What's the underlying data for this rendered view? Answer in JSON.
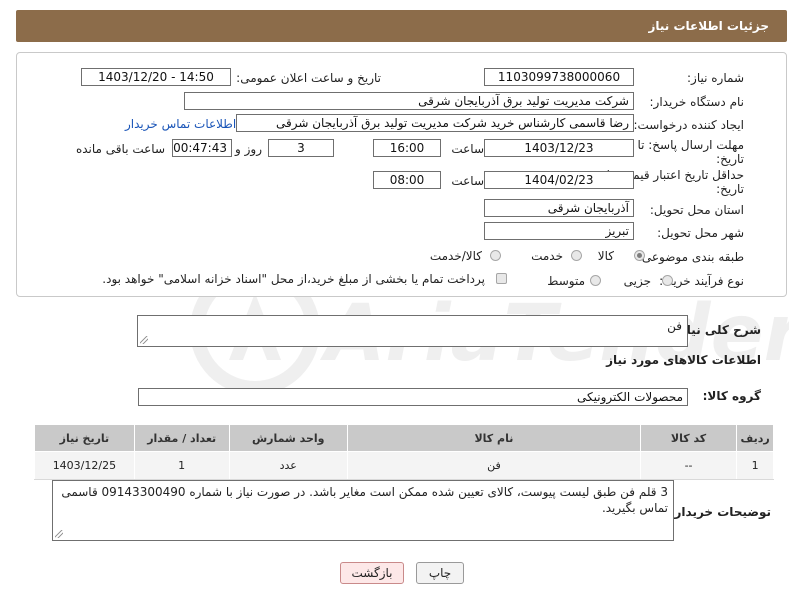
{
  "header": {
    "title": "جزئیات اطلاعات نیاز"
  },
  "form": {
    "need_number": {
      "label": "شماره نیاز:",
      "value": "1103099738000060"
    },
    "announce": {
      "label": "تاریخ و ساعت اعلان عمومی:",
      "value": "1403/12/20 - 14:50"
    },
    "buyer_org": {
      "label": "نام دستگاه خریدار:",
      "value": "شرکت مدیریت تولید برق آذربایجان شرقی"
    },
    "requester": {
      "label": "ایجاد کننده درخواست:",
      "value": "رضا قاسمی کارشناس خرید شرکت مدیریت تولید برق آذربایجان شرقی",
      "contact_link": "اطلاعات تماس خریدار"
    },
    "reply_deadline": {
      "label_line1": "مهلت ارسال پاسخ: تا",
      "label_line2": "تاریخ:",
      "date": "1403/12/23",
      "time_label": "ساعت",
      "time": "16:00",
      "days": "3",
      "days_label": "روز و",
      "remaining": "00:47:43",
      "remaining_label": "ساعت باقی مانده"
    },
    "price_validity": {
      "label_line1": "حداقل تاریخ اعتبار قیمت: تا",
      "label_line2": "تاریخ:",
      "date": "1404/02/23",
      "time_label": "ساعت",
      "time": "08:00"
    },
    "province": {
      "label": "استان محل تحویل:",
      "value": "آذربایجان شرقی"
    },
    "city": {
      "label": "شهر محل تحویل:",
      "value": "تبریز"
    },
    "category": {
      "label": "طبقه بندی موضوعی:",
      "opt_goods": "کالا",
      "opt_service": "خدمت",
      "opt_both": "کالا/خدمت"
    },
    "purchase_process": {
      "label": "نوع فرآیند خرید :",
      "opt_partial": "جزیی",
      "opt_medium": "متوسط",
      "note": "پرداخت تمام یا بخشی از مبلغ خرید،از محل \"اسناد خزانه اسلامی\" خواهد بود."
    }
  },
  "summary": {
    "label": "شرح کلی نیاز:",
    "value": "فن"
  },
  "goods_info": {
    "title": "اطلاعات کالاهای مورد نیاز"
  },
  "goods_group": {
    "label": "گروه کالا:",
    "value": "محصولات الکترونیکی"
  },
  "table": {
    "headers": [
      "ردیف",
      "کد کالا",
      "نام کالا",
      "واحد شمارش",
      "تعداد / مقدار",
      "تاریخ نیاز"
    ],
    "rows": [
      [
        "1",
        "--",
        "فن",
        "عدد",
        "1",
        "1403/12/25"
      ]
    ]
  },
  "buyer_notes": {
    "label": "توضیحات خریدار:",
    "value": "3 قلم فن طبق لیست پیوست، کالای تعیین شده ممکن است مغایر باشد. در صورت نیاز با شماره 09143300490 قاسمی تماس بگیرید."
  },
  "buttons": {
    "print": "چاپ",
    "back": "بازگشت"
  },
  "colors": {
    "header": "#8c6c4a",
    "link": "#1a55b8",
    "back_button": "#fde8e8",
    "table_header": "#c9c9c9"
  }
}
